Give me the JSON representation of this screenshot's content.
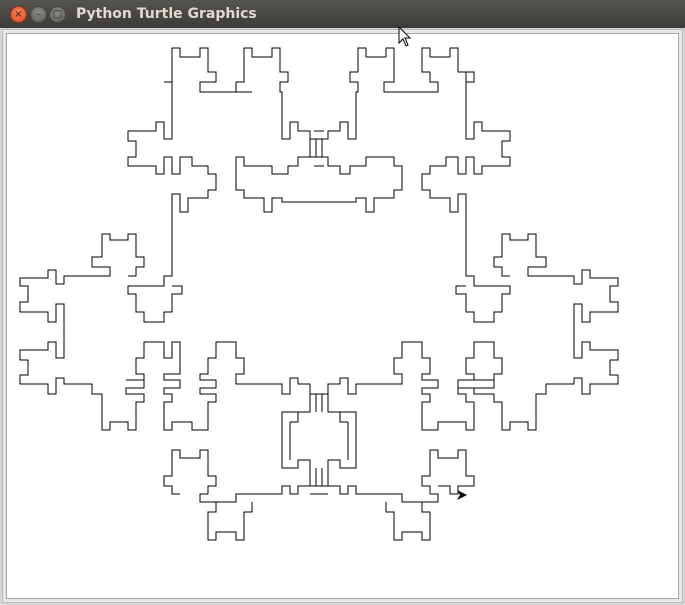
{
  "window": {
    "title": "Python Turtle Graphics",
    "buttons": {
      "close": "×",
      "minimize": "–",
      "maximize": "□"
    }
  },
  "drawing": {
    "description_icon": "turtle-arrow-icon",
    "stroke_color": "#000000",
    "background_color": "#ffffff"
  }
}
